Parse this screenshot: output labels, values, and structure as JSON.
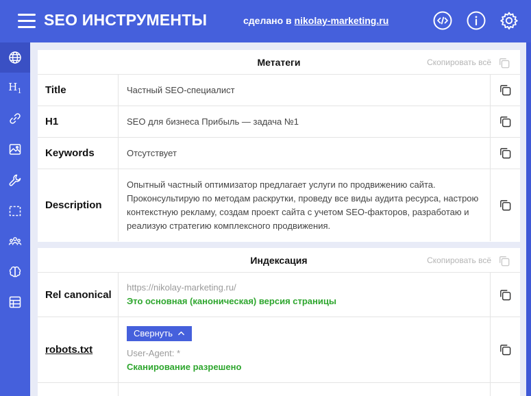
{
  "header": {
    "title": "SEO ИНСТРУМЕНТЫ",
    "made_by_prefix": "сделано в",
    "made_by_link": "nikolay-marketing.ru"
  },
  "sidebar": {
    "h1_label": "H",
    "h1_sub": "1",
    "items": [
      "globe-icon",
      "h1-icon",
      "link-icon",
      "image-icon",
      "wrench-icon",
      "selection-icon",
      "users-icon",
      "brain-icon",
      "table-icon"
    ]
  },
  "meta": {
    "title": "Метатеги",
    "copy_all": "Скопировать всё",
    "rows": [
      {
        "label": "Title",
        "value": "Частный SEO-специалист"
      },
      {
        "label": "H1",
        "value": "SEO для бизнеса Прибыль — задача №1"
      },
      {
        "label": "Keywords",
        "value": "Отсутствует"
      },
      {
        "label": "Description",
        "value": "Опытный частный оптимизатор предлагает услуги по продвижению сайта. Проконсультирую по методам раскрутки, проведу все виды аудита ресурса, настрою контекстную рекламу, создам проект сайта с учетом SEO-факторов, разработаю и реализую стратегию комплексного продвижения."
      }
    ]
  },
  "indexing": {
    "title": "Индексация",
    "copy_all": "Скопировать всё",
    "canonical": {
      "label": "Rel canonical",
      "url": "https://nikolay-marketing.ru/",
      "status": "Это основная (каноническая) версия страницы"
    },
    "robots": {
      "label": "robots.txt",
      "collapse_label": "Свернуть",
      "user_agent": "User-Agent: *",
      "status": "Сканирование разрешено"
    }
  },
  "colors": {
    "brand": "#4560dc",
    "green": "#2ea62e",
    "muted": "#b5b5b5"
  }
}
